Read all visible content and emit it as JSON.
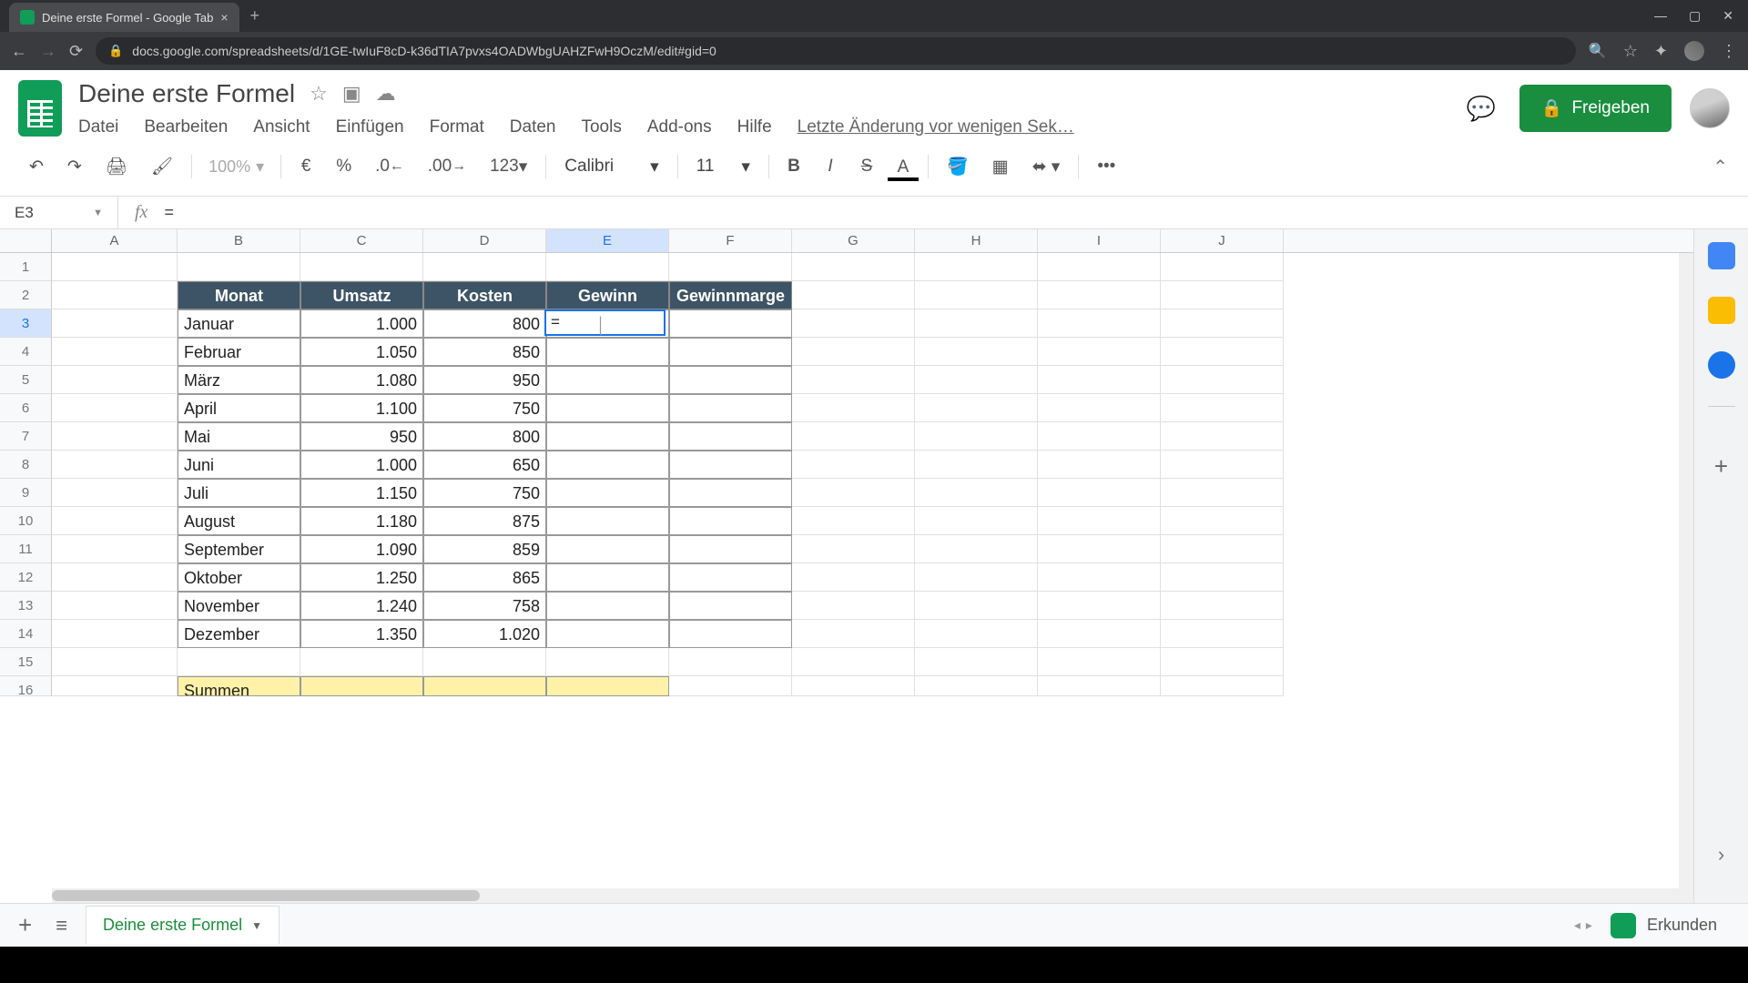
{
  "browser": {
    "tab_title": "Deine erste Formel - Google Tab",
    "url": "docs.google.com/spreadsheets/d/1GE-twIuF8cD-k36dTIA7pvxs4OADWbgUAHZFwH9OczM/edit#gid=0"
  },
  "doc": {
    "title": "Deine erste Formel",
    "menus": [
      "Datei",
      "Bearbeiten",
      "Ansicht",
      "Einfügen",
      "Format",
      "Daten",
      "Tools",
      "Add-ons",
      "Hilfe"
    ],
    "last_edit": "Letzte Änderung vor wenigen Sek…",
    "share": "Freigeben"
  },
  "toolbar": {
    "zoom": "100%",
    "currency": "€",
    "percent": "%",
    "dec_less": ".0",
    "dec_more": ".00",
    "num_fmt": "123",
    "font": "Calibri",
    "font_size": "11",
    "more": "•••"
  },
  "formula_bar": {
    "cell_ref": "E3",
    "fx": "fx",
    "value": "="
  },
  "columns": [
    "A",
    "B",
    "C",
    "D",
    "E",
    "F",
    "G",
    "H",
    "I",
    "J"
  ],
  "active_col": "E",
  "active_row": 3,
  "active_cell_value": "=",
  "table": {
    "headers": [
      "Monat",
      "Umsatz",
      "Kosten",
      "Gewinn",
      "Gewinnmarge"
    ],
    "rows": [
      {
        "monat": "Januar",
        "umsatz": "1.000",
        "kosten": "800"
      },
      {
        "monat": "Februar",
        "umsatz": "1.050",
        "kosten": "850"
      },
      {
        "monat": "März",
        "umsatz": "1.080",
        "kosten": "950"
      },
      {
        "monat": "April",
        "umsatz": "1.100",
        "kosten": "750"
      },
      {
        "monat": "Mai",
        "umsatz": "950",
        "kosten": "800"
      },
      {
        "monat": "Juni",
        "umsatz": "1.000",
        "kosten": "650"
      },
      {
        "monat": "Juli",
        "umsatz": "1.150",
        "kosten": "750"
      },
      {
        "monat": "August",
        "umsatz": "1.180",
        "kosten": "875"
      },
      {
        "monat": "September",
        "umsatz": "1.090",
        "kosten": "859"
      },
      {
        "monat": "Oktober",
        "umsatz": "1.250",
        "kosten": "865"
      },
      {
        "monat": "November",
        "umsatz": "1.240",
        "kosten": "758"
      },
      {
        "monat": "Dezember",
        "umsatz": "1.350",
        "kosten": "1.020"
      }
    ],
    "sum_label": "Summen"
  },
  "sheet_tab": "Deine erste Formel",
  "explore": "Erkunden"
}
